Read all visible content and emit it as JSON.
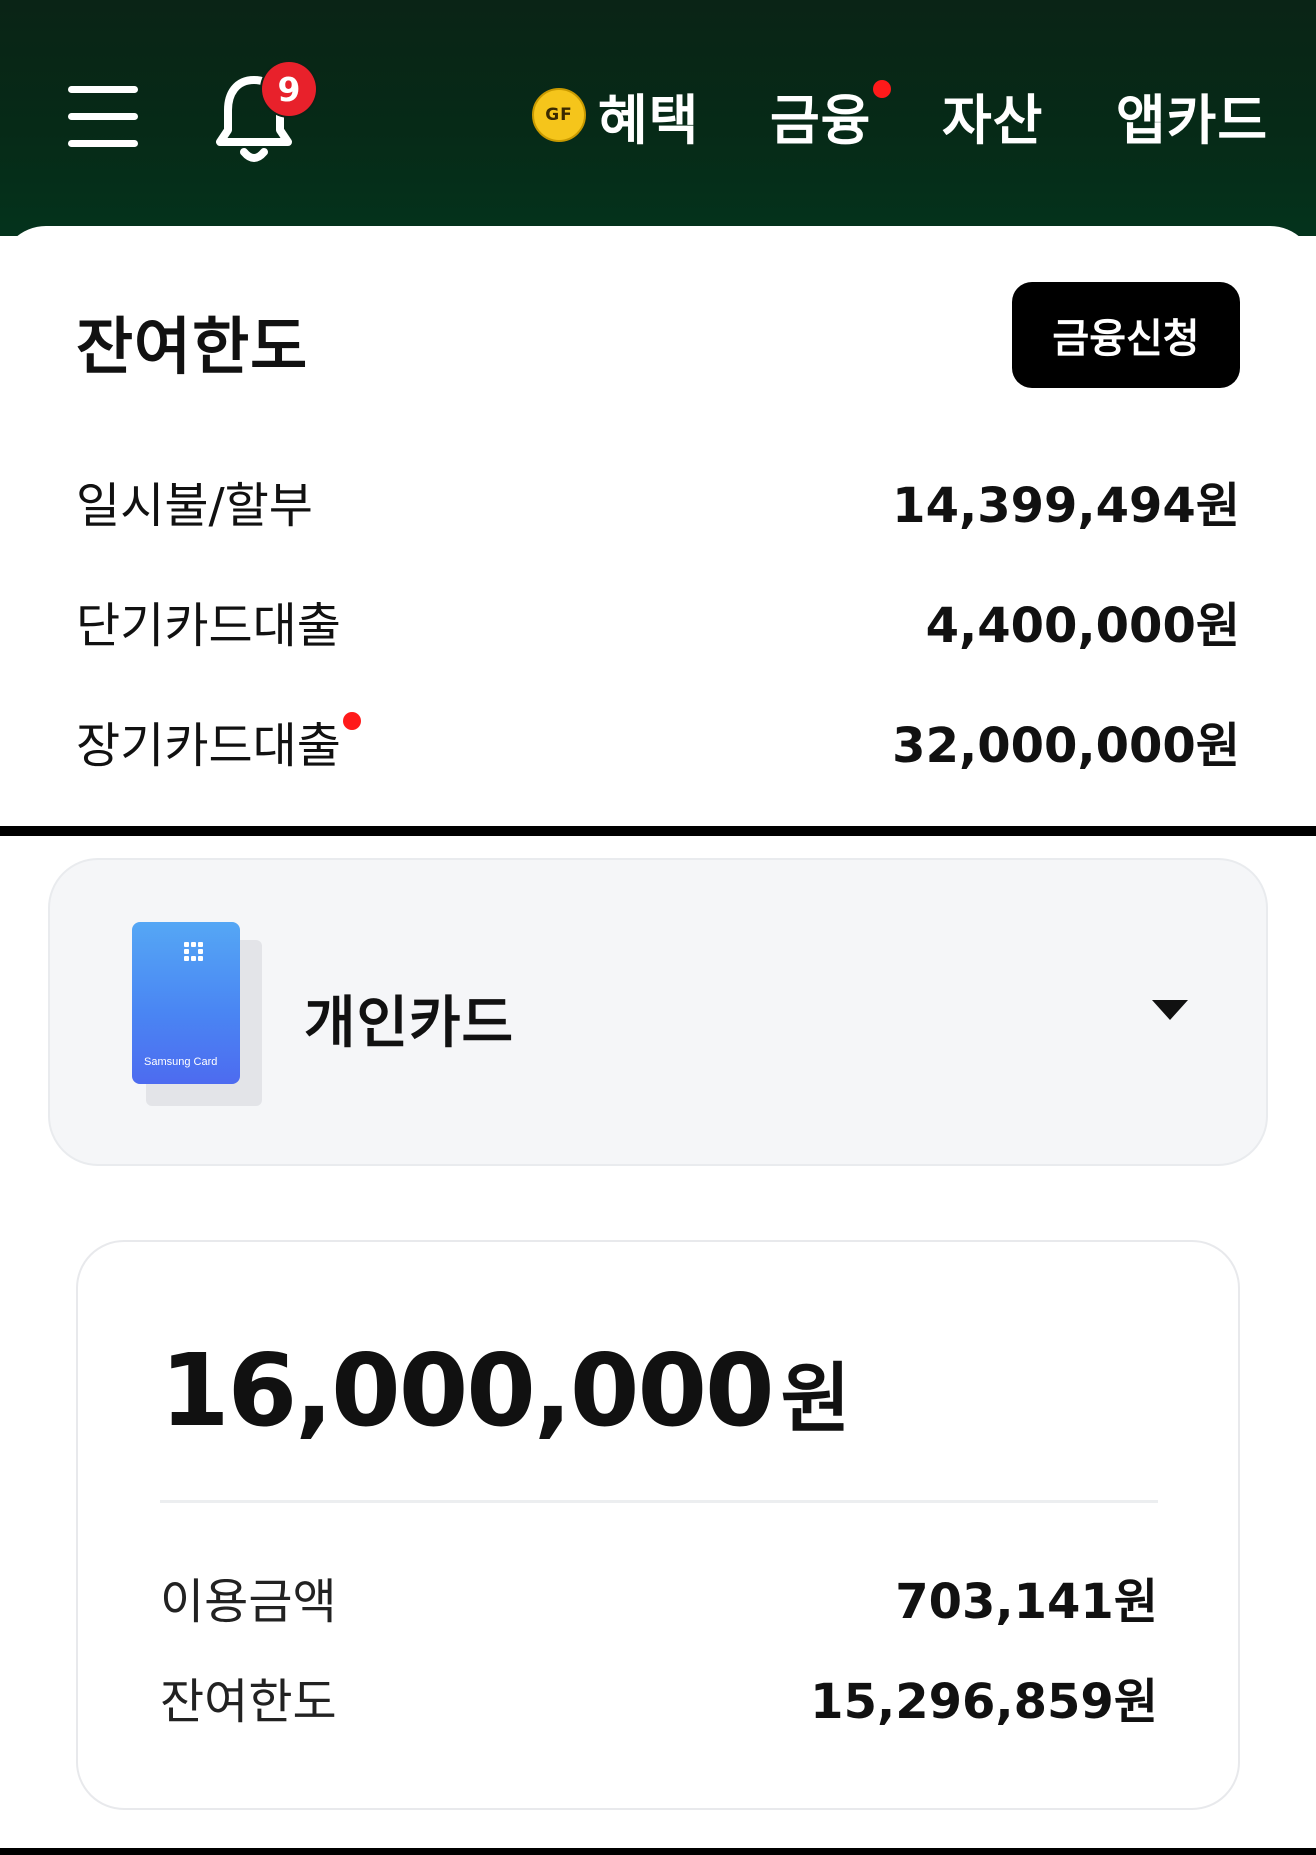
{
  "header": {
    "notification_count": "9",
    "nav": {
      "benefit_icon_text": "GF",
      "benefit": "혜택",
      "finance": "금융",
      "asset": "자산",
      "appcard": "앱카드"
    }
  },
  "limit": {
    "title": "잔여한도",
    "apply_button": "금융신청",
    "rows": [
      {
        "label": "일시불/할부",
        "value": "14,399,494원"
      },
      {
        "label": "단기카드대출",
        "value": "4,400,000원"
      },
      {
        "label": "장기카드대출",
        "value": "32,000,000원"
      }
    ]
  },
  "card_selector": {
    "card_brand": "Samsung Card",
    "selected": "개인카드"
  },
  "summary": {
    "total_amount": "16,000,000",
    "total_unit": "원",
    "rows": [
      {
        "label": "이용금액",
        "value": "703,141원"
      },
      {
        "label": "잔여한도",
        "value": "15,296,859원"
      }
    ]
  },
  "colors": {
    "header_bg": "#062a17",
    "badge": "#e8212b",
    "new_dot": "#ff1a1a",
    "card_blue": "#4a86f3"
  }
}
